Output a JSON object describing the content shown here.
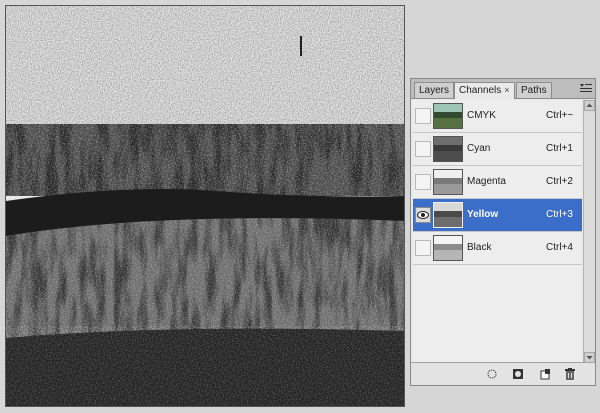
{
  "panel": {
    "tabs": [
      {
        "label": "Layers",
        "active": false
      },
      {
        "label": "Channels",
        "active": true,
        "close": "×"
      },
      {
        "label": "Paths",
        "active": false
      }
    ],
    "menu_icon": "panel-menu-icon",
    "channels": [
      {
        "name": "CMYK",
        "shortcut": "Ctrl+~",
        "visible": false,
        "selected": false,
        "thumb": "color"
      },
      {
        "name": "Cyan",
        "shortcut": "Ctrl+1",
        "visible": false,
        "selected": false,
        "thumb": "gray-dark"
      },
      {
        "name": "Magenta",
        "shortcut": "Ctrl+2",
        "visible": false,
        "selected": false,
        "thumb": "gray-light"
      },
      {
        "name": "Yellow",
        "shortcut": "Ctrl+3",
        "visible": true,
        "selected": true,
        "thumb": "gray-mid"
      },
      {
        "name": "Black",
        "shortcut": "Ctrl+4",
        "visible": false,
        "selected": false,
        "thumb": "gray-light"
      }
    ],
    "bottom_buttons": [
      "load-selection-icon",
      "save-selection-icon",
      "new-channel-icon",
      "trash-icon"
    ]
  },
  "colors": {
    "selection": "#3a6ec8",
    "panel_bg": "#e9e9e9",
    "workspace_bg": "#d6d6d6"
  }
}
